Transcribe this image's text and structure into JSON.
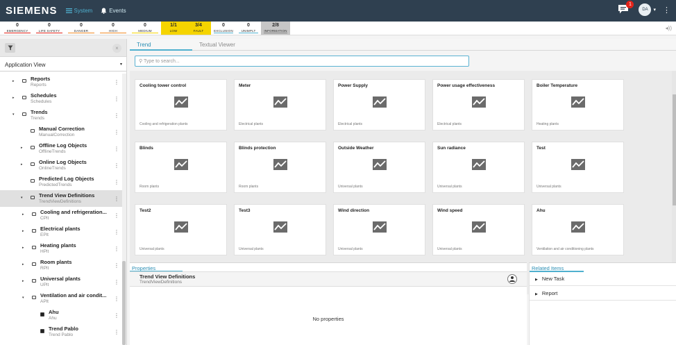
{
  "topbar": {
    "logo": "SIEMENS",
    "nav": [
      {
        "label": "System",
        "icon": "list-icon",
        "active": true
      },
      {
        "label": "Events",
        "icon": "bell-icon",
        "active": false
      }
    ],
    "notification_count": "1",
    "avatar_initials": "DA"
  },
  "alarms": [
    {
      "count": "0",
      "label": "EMERGENCY",
      "line": "#e2231a",
      "width": 46
    },
    {
      "count": "0",
      "label": "LIFE SAFETY",
      "line": "#e2231a",
      "width": 46
    },
    {
      "count": "0",
      "label": "DANGER",
      "line": "#f08a24",
      "width": 46
    },
    {
      "count": "0",
      "label": "HIGH",
      "line": "#f08a24",
      "width": 46
    },
    {
      "count": "0",
      "label": "MEDIUM",
      "line": "#f5d400",
      "width": 46
    },
    {
      "count": "1/1",
      "label": "LOW",
      "line": "#f5d400",
      "width": 36,
      "cls": "low"
    },
    {
      "count": "3/4",
      "label": "FAULT",
      "line": "#f5d400",
      "width": 36,
      "cls": "fault"
    },
    {
      "count": "0",
      "label": "EXCLUSION",
      "line": "#4fb0cf",
      "width": 36
    },
    {
      "count": "0",
      "label": "UNIMPLT",
      "line": "#4fb0cf",
      "width": 36
    },
    {
      "count": "2/8",
      "label": "INFORMATION",
      "line": "#888888",
      "width": 42,
      "cls": "info"
    }
  ],
  "left": {
    "view": "Application View",
    "tree": [
      {
        "title": "Reports",
        "sub": "Reports",
        "indent": 0,
        "exp": "▸",
        "icon": "folder"
      },
      {
        "title": "Schedules",
        "sub": "Schedules",
        "indent": 0,
        "exp": "▸",
        "icon": "folder"
      },
      {
        "title": "Trends",
        "sub": "Trends",
        "indent": 0,
        "exp": "▾",
        "icon": "folder"
      },
      {
        "title": "Manual Correction",
        "sub": "ManualCorrection",
        "indent": 1,
        "exp": "",
        "icon": "folder"
      },
      {
        "title": "Offline Log Objects",
        "sub": "OfflineTrends",
        "indent": 1,
        "exp": "▸",
        "icon": "folder"
      },
      {
        "title": "Online Log Objects",
        "sub": "OnlineTrends",
        "indent": 1,
        "exp": "▸",
        "icon": "folder"
      },
      {
        "title": "Predicted Log Objects",
        "sub": "PredictedTrends",
        "indent": 1,
        "exp": "",
        "icon": "folder"
      },
      {
        "title": "Trend View Definitions",
        "sub": "TrendViewDefinitions",
        "indent": 1,
        "exp": "▾",
        "icon": "folder",
        "selected": true
      },
      {
        "title": "Cooling and refrigeration...",
        "sub": "CPlt",
        "indent": 2,
        "exp": "▸",
        "icon": "folder"
      },
      {
        "title": "Electrical plants",
        "sub": "EPlt",
        "indent": 2,
        "exp": "▸",
        "icon": "folder"
      },
      {
        "title": "Heating plants",
        "sub": "HPlt",
        "indent": 2,
        "exp": "▸",
        "icon": "folder"
      },
      {
        "title": "Room plants",
        "sub": "RPlt",
        "indent": 2,
        "exp": "▸",
        "icon": "folder"
      },
      {
        "title": "Universal plants",
        "sub": "UPlt",
        "indent": 2,
        "exp": "▸",
        "icon": "folder"
      },
      {
        "title": "Ventilation and air condit...",
        "sub": "APlt",
        "indent": 2,
        "exp": "▾",
        "icon": "folder"
      },
      {
        "title": "Ahu",
        "sub": "Ahu",
        "indent": 3,
        "exp": "",
        "icon": "doc"
      },
      {
        "title": "Trend Pablo",
        "sub": "Trend Pablo",
        "indent": 3,
        "exp": "",
        "icon": "doc"
      }
    ]
  },
  "main": {
    "tabs": [
      "Trend",
      "Textual Viewer"
    ],
    "search_placeholder": "Type to search...",
    "cards": [
      {
        "title": "Cooling tower control",
        "sub": "Cooling and refrigeration plants"
      },
      {
        "title": "Meter",
        "sub": "Electrical plants"
      },
      {
        "title": "Power Supply",
        "sub": "Electrical plants"
      },
      {
        "title": "Power usage effectiveness",
        "sub": "Electrical plants"
      },
      {
        "title": "Boiler Temperature",
        "sub": "Heating plants"
      },
      {
        "title": "Blinds",
        "sub": "Room plants"
      },
      {
        "title": "Blinds protection",
        "sub": "Room plants"
      },
      {
        "title": "Outside Weather",
        "sub": "Universal plants"
      },
      {
        "title": "Sun radiance",
        "sub": "Universal plants"
      },
      {
        "title": "Test",
        "sub": "Universal plants"
      },
      {
        "title": "Test2",
        "sub": "Universal plants"
      },
      {
        "title": "Test3",
        "sub": "Universal plants"
      },
      {
        "title": "Wind direction",
        "sub": "Universal plants"
      },
      {
        "title": "Wind speed",
        "sub": "Universal plants"
      },
      {
        "title": "Ahu",
        "sub": "Ventilation and air conditioning plants"
      }
    ]
  },
  "properties": {
    "tab": "Properties",
    "title": "Trend View Definitions",
    "subtitle": "TrendViewDefinitions",
    "empty": "No properties"
  },
  "related": {
    "tab": "Related Items",
    "items": [
      "New Task",
      "Report"
    ]
  }
}
